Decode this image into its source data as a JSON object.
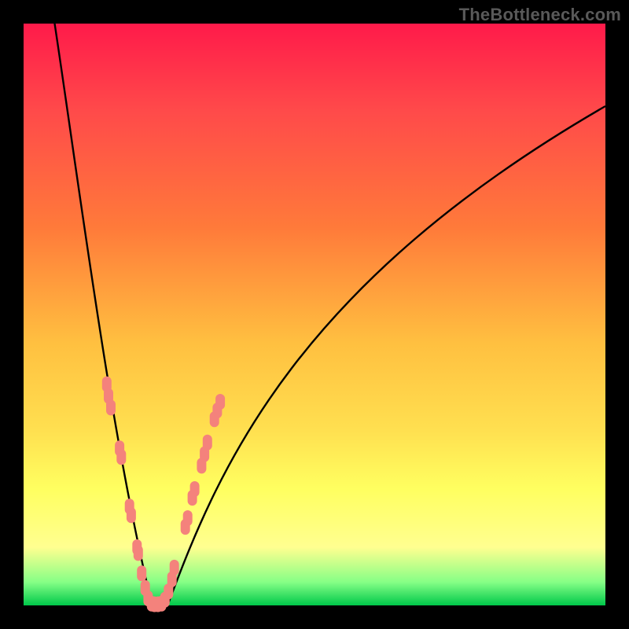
{
  "watermark": "TheBottleneck.com",
  "chart_data": {
    "type": "line",
    "title": "",
    "xlabel": "",
    "ylabel": "",
    "xlim": [
      0,
      100
    ],
    "ylim": [
      0,
      100
    ],
    "background_gradient": {
      "top": "#ff1a4a",
      "mid_upper": "#ff7a3a",
      "mid": "#ffe050",
      "lower": "#ffff90",
      "bottom": "#00c84a"
    },
    "series": [
      {
        "name": "bottleneck-curve",
        "description": "V-shaped bottleneck curve: steep descent from top-left, minimum near x≈22, shallower rise to upper right",
        "x_min": 22,
        "y_min": 0,
        "left_top": {
          "x": 5,
          "y": 100
        },
        "right_end": {
          "x": 100,
          "y": 86
        }
      }
    ],
    "markers": {
      "description": "Pink capsule-shaped markers clustered along the lower part of the V",
      "color": "#f4827c",
      "points_left": [
        {
          "x": 14.3,
          "y": 38
        },
        {
          "x": 14.6,
          "y": 36
        },
        {
          "x": 15.0,
          "y": 34
        },
        {
          "x": 16.5,
          "y": 27
        },
        {
          "x": 16.8,
          "y": 25.5
        },
        {
          "x": 18.2,
          "y": 17
        },
        {
          "x": 18.5,
          "y": 15.5
        },
        {
          "x": 19.5,
          "y": 10
        },
        {
          "x": 19.7,
          "y": 9
        },
        {
          "x": 20.3,
          "y": 5.5
        },
        {
          "x": 20.9,
          "y": 3
        },
        {
          "x": 21.4,
          "y": 1.2
        },
        {
          "x": 22.0,
          "y": 0.3
        }
      ],
      "points_bottom": [
        {
          "x": 22.5,
          "y": 0.2
        },
        {
          "x": 23.1,
          "y": 0.2
        },
        {
          "x": 23.7,
          "y": 0.3
        }
      ],
      "points_right": [
        {
          "x": 24.3,
          "y": 1.0
        },
        {
          "x": 24.9,
          "y": 2.4
        },
        {
          "x": 25.5,
          "y": 4.5
        },
        {
          "x": 25.9,
          "y": 6.5
        },
        {
          "x": 27.8,
          "y": 13.5
        },
        {
          "x": 28.2,
          "y": 15.0
        },
        {
          "x": 29.0,
          "y": 18.5
        },
        {
          "x": 29.4,
          "y": 20.0
        },
        {
          "x": 30.6,
          "y": 24.0
        },
        {
          "x": 31.1,
          "y": 26.0
        },
        {
          "x": 31.6,
          "y": 28.0
        },
        {
          "x": 32.8,
          "y": 32.0
        },
        {
          "x": 33.3,
          "y": 33.5
        },
        {
          "x": 33.8,
          "y": 35.0
        }
      ]
    }
  }
}
